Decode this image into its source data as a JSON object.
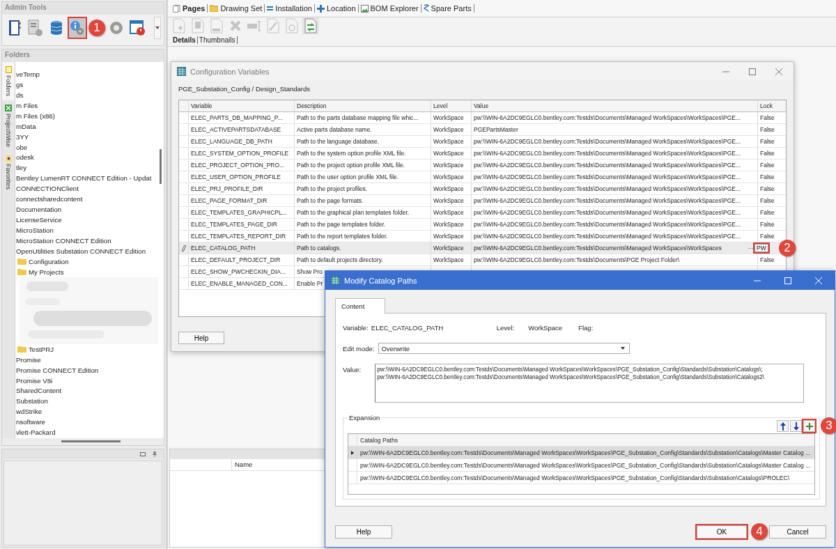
{
  "admin_tools": {
    "title": "Admin Tools",
    "buttons": [
      {
        "kind": "notebook",
        "highlighted": false
      },
      {
        "kind": "report",
        "highlighted": false
      },
      {
        "kind": "database",
        "highlighted": false
      },
      {
        "kind": "info-gear",
        "highlighted": true,
        "callout": "1"
      },
      {
        "kind": "gear",
        "highlighted": false
      },
      {
        "kind": "power-window",
        "highlighted": false
      }
    ]
  },
  "folders": {
    "title": "Folders",
    "side_tabs": [
      {
        "label": "Folders",
        "selected": true,
        "kind": "folder"
      },
      {
        "label": "ProjectWise",
        "selected": false,
        "kind": "projectwise"
      },
      {
        "label": "Favorites",
        "selected": false,
        "kind": "favorite"
      }
    ],
    "tree": [
      {
        "label": "veTemp"
      },
      {
        "label": "gs"
      },
      {
        "label": "ds"
      },
      {
        "label": "m Files"
      },
      {
        "label": "m Files (x86)"
      },
      {
        "label": "mData"
      },
      {
        "label": "3YY"
      },
      {
        "label": "obe"
      },
      {
        "label": "odesk"
      },
      {
        "label": "tley"
      },
      {
        "label": "Bentley LumenRT CONNECT Edition - Updat"
      },
      {
        "label": "CONNECTIONClient"
      },
      {
        "label": "connectsharedcontent"
      },
      {
        "label": "Documentation"
      },
      {
        "label": "LicenseService"
      },
      {
        "label": "MicroStation"
      },
      {
        "label": "MicroStation CONNECT Edition"
      },
      {
        "label": "OpenUtilities Substation CONNECT Edition",
        "children": [
          {
            "label": "Configuration",
            "kind": "folder"
          },
          {
            "label": "My Projects",
            "kind": "folder"
          },
          {
            "kind": "picture"
          },
          {
            "label": "TestPRJ",
            "kind": "folder"
          }
        ]
      },
      {
        "label": "Promise"
      },
      {
        "label": "Promise CONNECT Edition"
      },
      {
        "label": "Promise V8i"
      },
      {
        "label": "SharedContent"
      },
      {
        "label": "Substation"
      },
      {
        "label": "wdStrike"
      },
      {
        "label": "nsoftware"
      },
      {
        "label": "vlett-Packard"
      }
    ]
  },
  "tabs": [
    {
      "label": "Pages",
      "kind": "pages",
      "selected": true
    },
    {
      "label": "Drawing Set",
      "kind": "drawing-set",
      "selected": false
    },
    {
      "label": "Installation",
      "kind": "installation",
      "selected": false
    },
    {
      "label": "Location",
      "kind": "location",
      "selected": false
    },
    {
      "label": "BOM Explorer",
      "kind": "bom-explorer",
      "selected": false
    },
    {
      "label": "Spare Parts",
      "kind": "spare-parts",
      "selected": false
    }
  ],
  "page_toolbar": [
    {
      "kind": "new-page",
      "disabled": true
    },
    {
      "kind": "copy-page",
      "disabled": true
    },
    {
      "kind": "number-page",
      "disabled": true
    },
    {
      "kind": "delete",
      "disabled": true
    },
    {
      "kind": "rename",
      "disabled": true
    },
    {
      "kind": "edit",
      "disabled": true
    },
    {
      "kind": "refresh",
      "disabled": true
    },
    {
      "kind": "sync",
      "disabled": false
    }
  ],
  "subtabs": [
    {
      "label": "Details",
      "selected": true
    },
    {
      "label": "Thumbnails",
      "selected": false
    }
  ],
  "bottom_panel": {
    "columns": [
      "Name"
    ]
  },
  "config_dialog": {
    "title": "Configuration Variables",
    "path": "PGE_Substation_Config / Design_Standards",
    "columns": [
      "Variable",
      "Description",
      "Level",
      "Value",
      "Lock"
    ],
    "rows": [
      {
        "variable": "ELEC_PARTS_DB_MAPPING_P...",
        "description": "Path to the parts database mapping file whic...",
        "level": "WorkSpace",
        "value": "pw:\\\\WIN-6A2DC9EGLC0.bentley.com:Testds\\Documents\\Managed WorkSpaces\\WorkSpaces\\PGE...",
        "lock": "False",
        "editing": false
      },
      {
        "variable": "ELEC_ACTIVEPARTSDATABASE",
        "description": "Active parts database name.",
        "level": "WorkSpace",
        "value": "PGEPartsMaster",
        "lock": "False",
        "editing": false
      },
      {
        "variable": "ELEC_LANGUAGE_DB_PATH",
        "description": "Path to the language database.",
        "level": "WorkSpace",
        "value": "pw:\\\\WIN-6A2DC9EGLC0.bentley.com:Testds\\Documents\\Managed WorkSpaces\\WorkSpaces\\PGE...",
        "lock": "False",
        "editing": false
      },
      {
        "variable": "ELEC_SYSTEM_OPTION_PROFILE",
        "description": "Path to the system option profile XML file.",
        "level": "WorkSpace",
        "value": "pw:\\\\WIN-6A2DC9EGLC0.bentley.com:Testds\\Documents\\Managed WorkSpaces\\WorkSpaces\\PGE...",
        "lock": "False",
        "editing": false
      },
      {
        "variable": "ELEC_PROJECT_OPTION_PRO...",
        "description": "Path to the project option profile XML file.",
        "level": "WorkSpace",
        "value": "pw:\\\\WIN-6A2DC9EGLC0.bentley.com:Testds\\Documents\\Managed WorkSpaces\\WorkSpaces\\PGE...",
        "lock": "False",
        "editing": false
      },
      {
        "variable": "ELEC_USER_OPTION_PROFILE",
        "description": "Path to the user option profile XML file.",
        "level": "WorkSpace",
        "value": "pw:\\\\WIN-6A2DC9EGLC0.bentley.com:Testds\\Documents\\Managed WorkSpaces\\WorkSpaces\\PGE...",
        "lock": "False",
        "editing": false
      },
      {
        "variable": "ELEC_PRJ_PROFILE_DIR",
        "description": "Path to the project profiles.",
        "level": "WorkSpace",
        "value": "pw:\\\\WIN-6A2DC9EGLC0.bentley.com:Testds\\Documents\\Managed WorkSpaces\\WorkSpaces\\PGE...",
        "lock": "False",
        "editing": false
      },
      {
        "variable": "ELEC_PAGE_FORMAT_DIR",
        "description": "Path to the page formats.",
        "level": "WorkSpace",
        "value": "pw:\\\\WIN-6A2DC9EGLC0.bentley.com:Testds\\Documents\\Managed WorkSpaces\\WorkSpaces\\PGE...",
        "lock": "False",
        "editing": false
      },
      {
        "variable": "ELEC_TEMPLATES_GRAPHICPL...",
        "description": "Path to the graphical plan templates folder.",
        "level": "WorkSpace",
        "value": "pw:\\\\WIN-6A2DC9EGLC0.bentley.com:Testds\\Documents\\Managed WorkSpaces\\WorkSpaces\\PGE...",
        "lock": "False",
        "editing": false
      },
      {
        "variable": "ELEC_TEMPLATES_PAGE_DIR",
        "description": "Path to the page templates folder.",
        "level": "WorkSpace",
        "value": "pw:\\\\WIN-6A2DC9EGLC0.bentley.com:Testds\\Documents\\Managed WorkSpaces\\WorkSpaces\\PGE...",
        "lock": "False",
        "editing": false
      },
      {
        "variable": "ELEC_TEMPLATES_REPORT_DIR",
        "description": "Path to the report templates folder.",
        "level": "WorkSpace",
        "value": "pw:\\\\WIN-6A2DC9EGLC0.bentley.com:Testds\\Documents\\Managed WorkSpaces\\WorkSpaces\\PGE...",
        "lock": "False",
        "editing": false
      },
      {
        "variable": "ELEC_CATALOG_PATH",
        "description": "Path to catalogs.",
        "level": "WorkSpace",
        "value": "pw:\\\\WIN-6A2DC9EGLC0.bentley.com:Testds\\Documents\\Managed WorkSpaces\\WorkSpaces",
        "editing": true,
        "ellipsis_button": "···",
        "pw_button": "PW",
        "callout": "2"
      },
      {
        "variable": "ELEC_DEFAULT_PROJECT_DIR",
        "description": "Path to default projects directory.",
        "level": "WorkSpace",
        "value": "pw:\\\\WIN-6A2DC9EGLC0.bentley.com:Testds\\Documents\\PGE Project Folder\\",
        "lock": "False",
        "editing": false
      },
      {
        "variable": "ELEC_SHOW_PWCHECKIN_DIA...",
        "description": "Show Pro",
        "editing": false
      },
      {
        "variable": "ELEC_ENABLE_MANAGED_CON...",
        "description": "Enable Pr",
        "editing": false
      }
    ],
    "help_button": "Help"
  },
  "modify_dialog": {
    "title": "Modify Catalog Paths",
    "tab": "Content",
    "variable_label": "Variable:",
    "variable": "ELEC_CATALOG_PATH",
    "level_label": "Level:",
    "level": "WorkSpace",
    "flag_label": "Flag:",
    "edit_mode_label": "Edit mode:",
    "edit_mode": "Overwrite",
    "value_label": "Value:",
    "value": "pw:\\\\WIN-6A2DC9EGLC0.bentley.com:Testds\\Documents\\Managed WorkSpaces\\WorkSpaces\\PGE_Substation_Config\\Standards\\Substation\\Catalogs\\;\npw:\\\\WIN-6A2DC9EGLC0.bentley.com:Testds\\Documents\\Managed WorkSpaces\\WorkSpaces\\PGE_Substation_Config\\Standards\\Substation\\Catalogs2\\",
    "expansion_label": "Expansion",
    "add_callout": "3",
    "paths_header": "Catalog Paths",
    "paths": [
      {
        "text": "pw:\\\\WIN-6A2DC9EGLC0.bentley.com:Testds\\Documents\\Managed WorkSpaces\\WorkSpaces\\PGE_Substation_Config\\Standards\\Substation\\Catalogs\\Master Catalog ...",
        "selected": true
      },
      {
        "text": "pw:\\\\WIN-6A2DC9EGLC0.bentley.com:Testds\\Documents\\Managed WorkSpaces\\WorkSpaces\\PGE_Substation_Config\\Standards\\Substation\\Catalogs\\Master Catalog ...",
        "selected": false
      },
      {
        "text": "pw:\\\\WIN-6A2DC9EGLC0.bentley.com:Testds\\Documents\\Managed WorkSpaces\\WorkSpaces\\PGE_Substation_Config\\Standards\\Substation\\Catalogs\\PROLEC\\",
        "selected": false
      }
    ],
    "help_button": "Help",
    "ok_button": "OK",
    "ok_callout": "4",
    "cancel_button": "Cancel"
  }
}
